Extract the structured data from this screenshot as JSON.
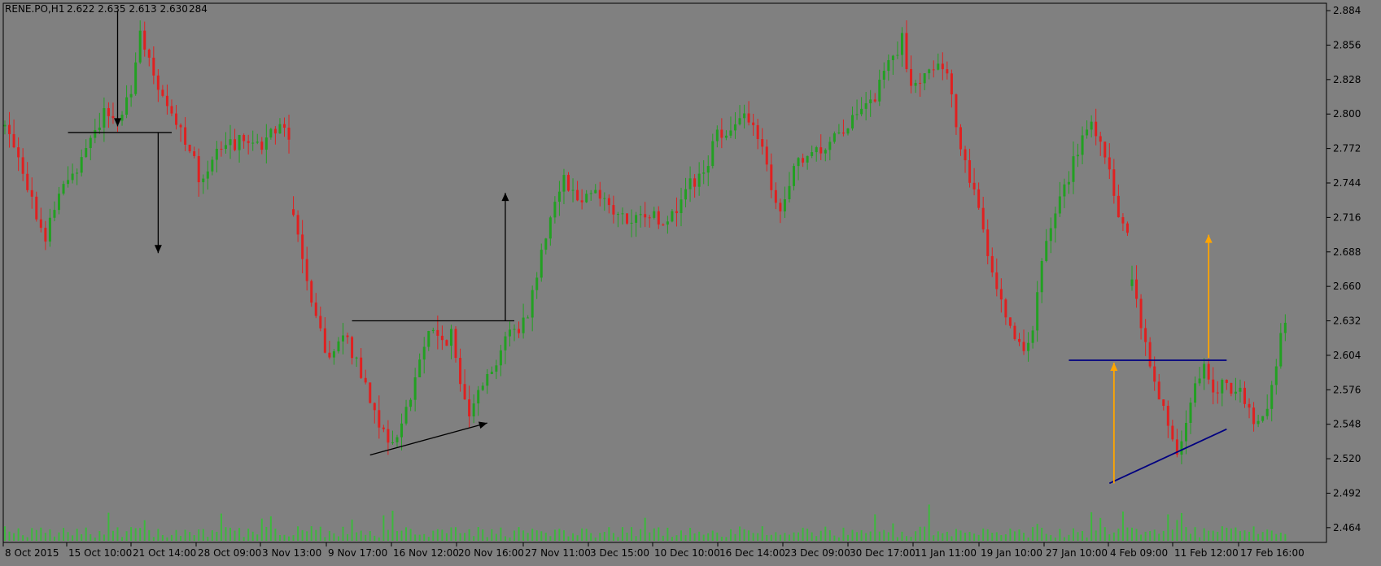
{
  "header": {
    "symbol": "RENE.PO,H1",
    "ohlc": "2.622 2.635 2.613 2.630",
    "volume": "284"
  },
  "colors": {
    "background": "#808080",
    "bull": "#22a022",
    "bear": "#e02020",
    "volume": "#3db83d",
    "annotation_black": "#000000",
    "annotation_orange": "#ffa500",
    "annotation_blue": "#000080"
  },
  "chart_data": {
    "type": "candlestick",
    "title": "RENE.PO,H1",
    "ylim": [
      2.452,
      2.89
    ],
    "y_ticks": [
      "2.884",
      "2.856",
      "2.828",
      "2.800",
      "2.772",
      "2.744",
      "2.716",
      "2.688",
      "2.660",
      "2.632",
      "2.604",
      "2.576",
      "2.548",
      "2.520",
      "2.492",
      "2.464"
    ],
    "x_ticks": [
      "8 Oct 2015",
      "15 Oct 10:00",
      "21 Oct 14:00",
      "28 Oct 09:00",
      "3 Nov 13:00",
      "9 Nov 17:00",
      "16 Nov 12:00",
      "20 Nov 16:00",
      "27 Nov 11:00",
      "3 Dec 15:00",
      "10 Dec 10:00",
      "16 Dec 14:00",
      "23 Dec 09:00",
      "30 Dec 17:00",
      "11 Jan 11:00",
      "19 Jan 10:00",
      "27 Jan 10:00",
      "4 Feb 09:00",
      "11 Feb 12:00",
      "17 Feb 16:00"
    ],
    "price_path": [
      [
        0,
        2.79
      ],
      [
        3,
        2.77
      ],
      [
        6,
        2.73
      ],
      [
        9,
        2.7
      ],
      [
        12,
        2.735
      ],
      [
        15,
        2.75
      ],
      [
        18,
        2.775
      ],
      [
        22,
        2.8
      ],
      [
        25,
        2.795
      ],
      [
        28,
        2.82
      ],
      [
        30,
        2.87
      ],
      [
        32,
        2.84
      ],
      [
        35,
        2.81
      ],
      [
        38,
        2.79
      ],
      [
        41,
        2.775
      ],
      [
        43,
        2.745
      ],
      [
        46,
        2.765
      ],
      [
        50,
        2.775
      ],
      [
        54,
        2.78
      ],
      [
        57,
        2.775
      ],
      [
        60,
        2.79
      ],
      [
        63,
        2.785
      ],
      [
        64,
        2.72
      ],
      [
        66,
        2.68
      ],
      [
        69,
        2.63
      ],
      [
        72,
        2.6
      ],
      [
        75,
        2.62
      ],
      [
        78,
        2.6
      ],
      [
        81,
        2.57
      ],
      [
        83,
        2.55
      ],
      [
        85,
        2.53
      ],
      [
        87,
        2.54
      ],
      [
        90,
        2.57
      ],
      [
        92,
        2.6
      ],
      [
        94,
        2.625
      ],
      [
        97,
        2.615
      ],
      [
        99,
        2.62
      ],
      [
        101,
        2.58
      ],
      [
        103,
        2.56
      ],
      [
        105,
        2.58
      ],
      [
        108,
        2.59
      ],
      [
        111,
        2.62
      ],
      [
        114,
        2.625
      ],
      [
        116,
        2.64
      ],
      [
        118,
        2.67
      ],
      [
        121,
        2.72
      ],
      [
        124,
        2.75
      ],
      [
        127,
        2.73
      ],
      [
        131,
        2.74
      ],
      [
        135,
        2.72
      ],
      [
        139,
        2.71
      ],
      [
        143,
        2.72
      ],
      [
        147,
        2.71
      ],
      [
        151,
        2.74
      ],
      [
        155,
        2.75
      ],
      [
        158,
        2.785
      ],
      [
        161,
        2.79
      ],
      [
        164,
        2.795
      ],
      [
        167,
        2.785
      ],
      [
        170,
        2.74
      ],
      [
        172,
        2.715
      ],
      [
        175,
        2.755
      ],
      [
        178,
        2.765
      ],
      [
        181,
        2.77
      ],
      [
        184,
        2.785
      ],
      [
        187,
        2.79
      ],
      [
        190,
        2.8
      ],
      [
        193,
        2.815
      ],
      [
        196,
        2.84
      ],
      [
        199,
        2.86
      ],
      [
        201,
        2.82
      ],
      [
        204,
        2.835
      ],
      [
        207,
        2.845
      ],
      [
        209,
        2.83
      ],
      [
        211,
        2.79
      ],
      [
        214,
        2.75
      ],
      [
        216,
        2.72
      ],
      [
        218,
        2.69
      ],
      [
        220,
        2.66
      ],
      [
        222,
        2.64
      ],
      [
        224,
        2.62
      ],
      [
        226,
        2.61
      ],
      [
        228,
        2.62
      ],
      [
        230,
        2.68
      ],
      [
        233,
        2.72
      ],
      [
        236,
        2.75
      ],
      [
        239,
        2.78
      ],
      [
        241,
        2.79
      ],
      [
        243,
        2.78
      ],
      [
        245,
        2.755
      ],
      [
        247,
        2.72
      ],
      [
        249,
        2.705
      ],
      [
        250,
        2.665
      ],
      [
        252,
        2.63
      ],
      [
        254,
        2.6
      ],
      [
        256,
        2.57
      ],
      [
        258,
        2.55
      ],
      [
        260,
        2.52
      ],
      [
        262,
        2.545
      ],
      [
        264,
        2.58
      ],
      [
        266,
        2.595
      ],
      [
        268,
        2.57
      ],
      [
        270,
        2.585
      ],
      [
        272,
        2.575
      ],
      [
        274,
        2.58
      ],
      [
        276,
        2.56
      ],
      [
        278,
        2.545
      ],
      [
        280,
        2.565
      ],
      [
        282,
        2.6
      ],
      [
        283,
        2.62
      ],
      [
        284,
        2.63
      ]
    ],
    "gaps_after_bar": [
      63,
      249
    ],
    "annotations": [
      {
        "kind": "arrow",
        "color": "black",
        "from": [
          25,
          2.884
        ],
        "to": [
          25,
          2.79
        ]
      },
      {
        "kind": "line",
        "color": "black",
        "from": [
          14,
          2.785
        ],
        "to": [
          37,
          2.785
        ]
      },
      {
        "kind": "arrow",
        "color": "black",
        "from": [
          34,
          2.785
        ],
        "to": [
          34,
          2.687
        ]
      },
      {
        "kind": "line",
        "color": "black",
        "from": [
          77,
          2.632
        ],
        "to": [
          113,
          2.632
        ]
      },
      {
        "kind": "arrow",
        "color": "black",
        "from": [
          111,
          2.632
        ],
        "to": [
          111,
          2.736
        ]
      },
      {
        "kind": "arrow",
        "color": "black",
        "from": [
          81,
          2.523
        ],
        "to": [
          107,
          2.549
        ]
      },
      {
        "kind": "line",
        "color": "blue",
        "from": [
          236,
          2.6
        ],
        "to": [
          271,
          2.6
        ]
      },
      {
        "kind": "line",
        "color": "blue",
        "from": [
          245,
          2.5
        ],
        "to": [
          271,
          2.544
        ]
      },
      {
        "kind": "arrow",
        "color": "orange",
        "from": [
          246,
          2.5
        ],
        "to": [
          246,
          2.598
        ]
      },
      {
        "kind": "arrow",
        "color": "orange",
        "from": [
          267,
          2.602
        ],
        "to": [
          267,
          2.702
        ]
      }
    ]
  }
}
